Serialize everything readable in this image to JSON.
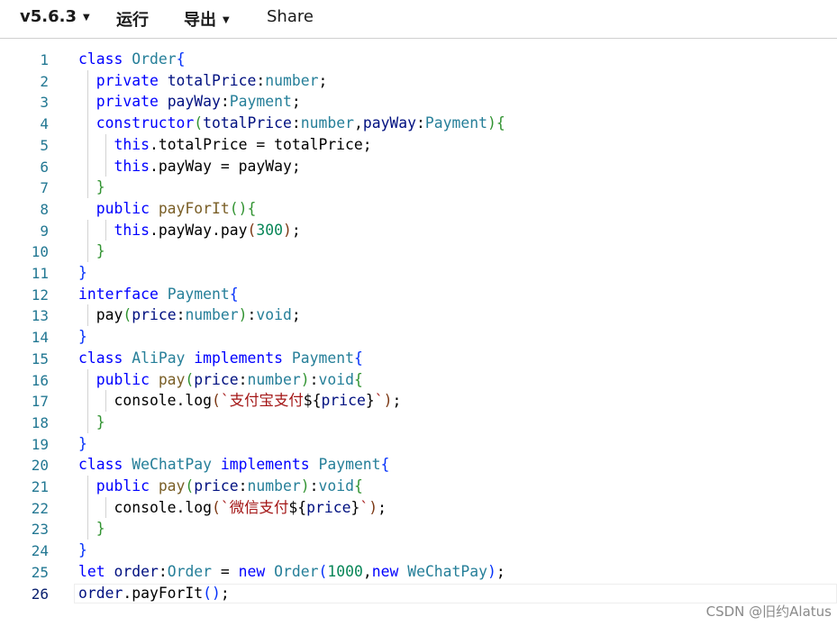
{
  "toolbar": {
    "version_label": "v5.6.3",
    "run_label": "运行",
    "export_label": "导出",
    "share_label": "Share"
  },
  "editor": {
    "active_line": 26,
    "lines": [
      [
        [
          "kw",
          "class "
        ],
        [
          "cls",
          "Order"
        ],
        [
          "br1",
          "{"
        ]
      ],
      [
        [
          "kw",
          "  private "
        ],
        [
          "prop",
          "totalPrice"
        ],
        [
          "",
          ":"
        ],
        [
          "ty",
          "number"
        ],
        [
          "",
          ";"
        ]
      ],
      [
        [
          "kw",
          "  private "
        ],
        [
          "prop",
          "payWay"
        ],
        [
          "",
          ":"
        ],
        [
          "ty",
          "Payment"
        ],
        [
          "",
          ";"
        ]
      ],
      [
        [
          "kw",
          "  constructor"
        ],
        [
          "br2",
          "("
        ],
        [
          "prop",
          "totalPrice"
        ],
        [
          "",
          ":"
        ],
        [
          "ty",
          "number"
        ],
        [
          "",
          ","
        ],
        [
          "prop",
          "payWay"
        ],
        [
          "",
          ":"
        ],
        [
          "ty",
          "Payment"
        ],
        [
          "br2",
          ")"
        ],
        [
          "br2",
          "{"
        ]
      ],
      [
        [
          "kw",
          "    this"
        ],
        [
          "",
          ".totalPrice = totalPrice;"
        ]
      ],
      [
        [
          "kw",
          "    this"
        ],
        [
          "",
          ".payWay = payWay;"
        ]
      ],
      [
        [
          "br2",
          "  }"
        ]
      ],
      [
        [
          "kw",
          "  public "
        ],
        [
          "fn",
          "payForIt"
        ],
        [
          "br2",
          "(){"
        ]
      ],
      [
        [
          "kw",
          "    this"
        ],
        [
          "",
          ".payWay.pay"
        ],
        [
          "br3",
          "("
        ],
        [
          "num",
          "300"
        ],
        [
          "br3",
          ")"
        ],
        [
          "",
          ";"
        ]
      ],
      [
        [
          "br2",
          "  }"
        ]
      ],
      [
        [
          "br1",
          "}"
        ]
      ],
      [
        [
          "kw",
          "interface "
        ],
        [
          "cls",
          "Payment"
        ],
        [
          "br1",
          "{"
        ]
      ],
      [
        [
          "",
          "  pay"
        ],
        [
          "br2",
          "("
        ],
        [
          "prop",
          "price"
        ],
        [
          "",
          ":"
        ],
        [
          "ty",
          "number"
        ],
        [
          "br2",
          ")"
        ],
        [
          "",
          ":"
        ],
        [
          "ty",
          "void"
        ],
        [
          "",
          ";"
        ]
      ],
      [
        [
          "br1",
          "}"
        ]
      ],
      [
        [
          "kw",
          "class "
        ],
        [
          "cls",
          "AliPay "
        ],
        [
          "kw",
          "implements "
        ],
        [
          "cls",
          "Payment"
        ],
        [
          "br1",
          "{"
        ]
      ],
      [
        [
          "kw",
          "  public "
        ],
        [
          "fn",
          "pay"
        ],
        [
          "br2",
          "("
        ],
        [
          "prop",
          "price"
        ],
        [
          "",
          ":"
        ],
        [
          "ty",
          "number"
        ],
        [
          "br2",
          ")"
        ],
        [
          "",
          ":"
        ],
        [
          "ty",
          "void"
        ],
        [
          "br2",
          "{"
        ]
      ],
      [
        [
          "",
          "    console.log"
        ],
        [
          "br3",
          "("
        ],
        [
          "str",
          "`支付宝支付"
        ],
        [
          "",
          "${"
        ],
        [
          "prop",
          "price"
        ],
        [
          "",
          "}"
        ],
        [
          "str",
          "`"
        ],
        [
          "br3",
          ")"
        ],
        [
          "",
          ";"
        ]
      ],
      [
        [
          "br2",
          "  }"
        ]
      ],
      [
        [
          "br1",
          "}"
        ]
      ],
      [
        [
          "kw",
          "class "
        ],
        [
          "cls",
          "WeChatPay "
        ],
        [
          "kw",
          "implements "
        ],
        [
          "cls",
          "Payment"
        ],
        [
          "br1",
          "{"
        ]
      ],
      [
        [
          "kw",
          "  public "
        ],
        [
          "fn",
          "pay"
        ],
        [
          "br2",
          "("
        ],
        [
          "prop",
          "price"
        ],
        [
          "",
          ":"
        ],
        [
          "ty",
          "number"
        ],
        [
          "br2",
          ")"
        ],
        [
          "",
          ":"
        ],
        [
          "ty",
          "void"
        ],
        [
          "br2",
          "{"
        ]
      ],
      [
        [
          "",
          "    console.log"
        ],
        [
          "br3",
          "("
        ],
        [
          "str",
          "`微信支付"
        ],
        [
          "",
          "${"
        ],
        [
          "prop",
          "price"
        ],
        [
          "",
          "}"
        ],
        [
          "str",
          "`"
        ],
        [
          "br3",
          ")"
        ],
        [
          "",
          ";"
        ]
      ],
      [
        [
          "br2",
          "  }"
        ]
      ],
      [
        [
          "br1",
          "}"
        ]
      ],
      [
        [
          "kw",
          "let "
        ],
        [
          "prop",
          "order"
        ],
        [
          "",
          ":"
        ],
        [
          "cls",
          "Order"
        ],
        [
          "",
          " = "
        ],
        [
          "kw",
          "new "
        ],
        [
          "cls",
          "Order"
        ],
        [
          "br1",
          "("
        ],
        [
          "num",
          "1000"
        ],
        [
          "",
          ","
        ],
        [
          "kw",
          "new "
        ],
        [
          "cls",
          "WeChatPay"
        ],
        [
          "br1",
          ")"
        ],
        [
          "",
          ";"
        ]
      ],
      [
        [
          "prop",
          "order"
        ],
        [
          "",
          ".payForIt"
        ],
        [
          "br1",
          "()"
        ],
        [
          "",
          ";"
        ]
      ]
    ]
  },
  "colors": {
    "keyword": "#0000ff",
    "type": "#267f99",
    "number": "#098658",
    "line_number": "#237893"
  },
  "watermark": "CSDN @旧约Alatus"
}
